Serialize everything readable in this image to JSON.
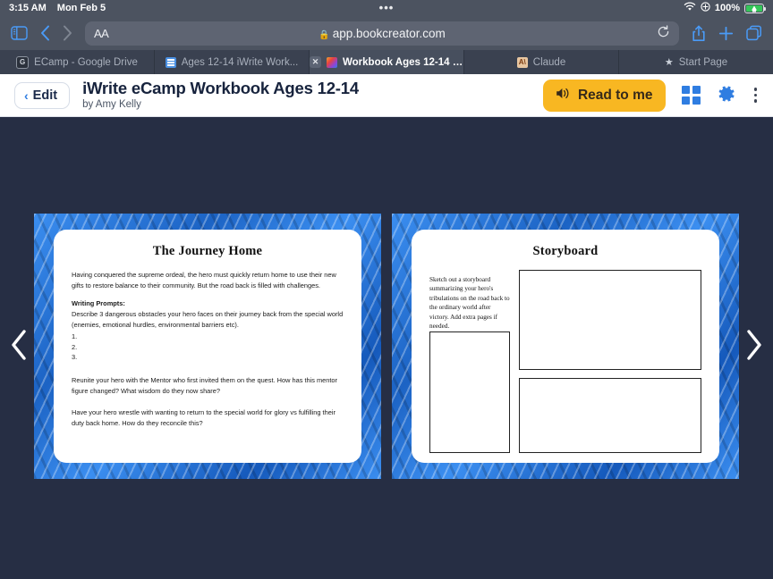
{
  "status_bar": {
    "time": "3:15 AM",
    "date": "Mon Feb 5",
    "dots": "•••",
    "wifi_icon": "wifi-icon",
    "location_icon": "location-icon",
    "battery_percent": "100%",
    "battery_icon": "battery-charging-icon"
  },
  "browser": {
    "sidebar_icon": "sidebar-icon",
    "back_icon": "chevron-left-icon",
    "forward_icon": "chevron-right-icon",
    "text_size_label": "AA",
    "lock_icon": "lock-icon",
    "url": "app.bookcreator.com",
    "reload_icon": "reload-icon",
    "share_icon": "share-icon",
    "new_tab_icon": "plus-icon",
    "tabs_overview_icon": "tabs-icon",
    "tabs": [
      {
        "label": "ECamp - Google Drive",
        "favicon": "google-drive-icon",
        "favicon_text": "G",
        "active": false,
        "closable": false
      },
      {
        "label": "Ages 12-14 iWrite Work...",
        "favicon": "google-docs-icon",
        "favicon_text": "",
        "active": false,
        "closable": false
      },
      {
        "label": "Workbook Ages 12-14 b...",
        "favicon": "bookcreator-icon",
        "favicon_text": "",
        "active": true,
        "closable": true,
        "close_icon": "close-icon"
      },
      {
        "label": "Claude",
        "favicon": "claude-icon",
        "favicon_text": "A\\",
        "active": false,
        "closable": false
      },
      {
        "label": "Start Page",
        "favicon": "star-icon",
        "favicon_text": "★",
        "active": false,
        "closable": false
      }
    ]
  },
  "app_header": {
    "edit_label": "Edit",
    "edit_chevron_icon": "chevron-left-icon",
    "book_title": "iWrite eCamp Workbook Ages 12-14",
    "byline": "by Amy Kelly",
    "read_to_me_label": "Read to me",
    "speaker_icon": "speaker-icon",
    "grid_view_icon": "grid-view-icon",
    "settings_icon": "gear-icon",
    "more_icon": "kebab-menu-icon",
    "accent_color": "#2f7de1",
    "read_button_color": "#f8b722"
  },
  "reader": {
    "prev_page_icon": "chevron-left-icon",
    "next_page_icon": "chevron-right-icon",
    "background_color": "#262e44",
    "border_color": "#1f6fd0",
    "left_page": {
      "title": "The Journey Home",
      "intro": "Having conquered the supreme ordeal, the hero must quickly return home to use their new gifts to restore balance to their community. But the road back is filled with challenges.",
      "prompts_heading": "Writing Prompts:",
      "prompt_1": "Describe 3 dangerous obstacles your hero faces on their journey back from the special world (enemies, emotional hurdles, environmental barriers etc).",
      "numbered_items": [
        "1.",
        "2.",
        "3."
      ],
      "prompt_2": "Reunite your hero with the Mentor who first invited them on the quest. How has this mentor figure changed? What wisdom do they now share?",
      "prompt_3": "Have your hero wrestle with wanting to return to the special world for glory vs fulfilling their duty back home. How do they reconcile this?"
    },
    "right_page": {
      "title": "Storyboard",
      "note": "Sketch out a storyboard summarizing your hero's tribulations on the road back to the ordinary world after victory.  Add extra pages if needed.",
      "boxes": [
        "storyboard-box-1",
        "storyboard-box-2",
        "storyboard-box-3"
      ]
    }
  }
}
